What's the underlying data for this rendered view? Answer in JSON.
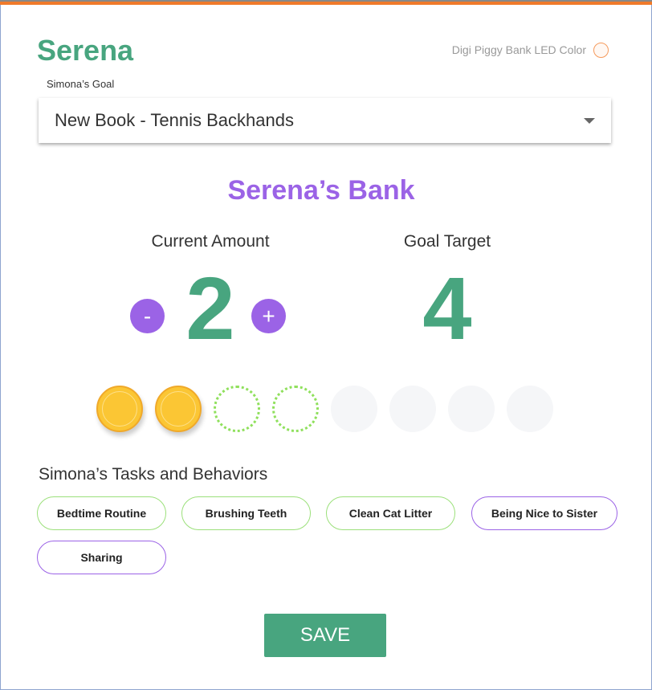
{
  "header": {
    "child_name": "Serena",
    "led_label": "Digi Piggy Bank LED Color",
    "led_color": "#f59a5c"
  },
  "goal": {
    "label": "Simona’s Goal",
    "selected": "New Book - Tennis Backhands"
  },
  "bank": {
    "title": "Serena’s Bank",
    "current_label": "Current Amount",
    "current_value": "2",
    "goal_label": "Goal Target",
    "goal_value": "4",
    "minus_label": "-",
    "plus_label": "+"
  },
  "coins": {
    "filled": 2,
    "target": 4,
    "total": 8
  },
  "tasks": {
    "title": "Simona’s Tasks and Behaviors",
    "items": [
      {
        "label": "Bedtime Routine",
        "style": "green"
      },
      {
        "label": "Brushing Teeth",
        "style": "green"
      },
      {
        "label": "Clean Cat Litter",
        "style": "green"
      },
      {
        "label": "Being Nice to Sister",
        "style": "purple"
      },
      {
        "label": "Sharing",
        "style": "purple"
      }
    ]
  },
  "save_label": "SAVE"
}
